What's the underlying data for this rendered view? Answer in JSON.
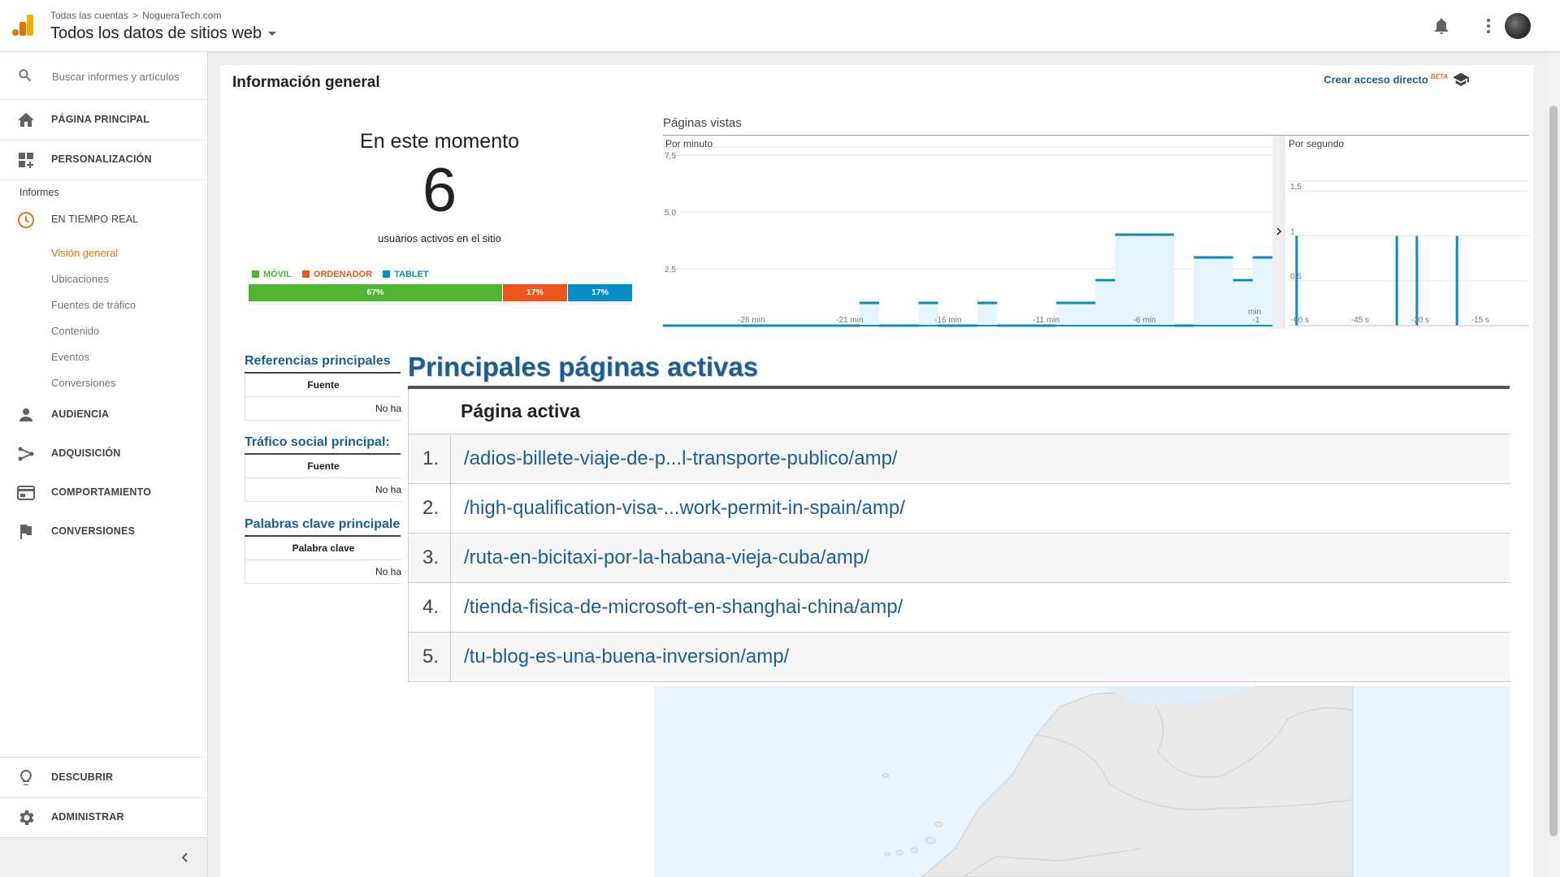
{
  "header": {
    "breadcrumb_root": "Todas las cuentas",
    "breadcrumb_sep": ">",
    "breadcrumb_account": "NogueraTech.com",
    "view_title": "Todos los datos de sitios web"
  },
  "sidebar": {
    "search_placeholder": "Buscar informes y artículos",
    "home": "PÁGINA PRINCIPAL",
    "customization": "PERSONALIZACIÓN",
    "reports_label": "Informes",
    "realtime": "EN TIEMPO REAL",
    "realtime_items": [
      "Visión general",
      "Ubicaciones",
      "Fuentes de tráfico",
      "Contenido",
      "Eventos",
      "Conversiones"
    ],
    "audience": "AUDIENCIA",
    "acquisition": "ADQUISICIÓN",
    "behavior": "COMPORTAMIENTO",
    "conversions": "CONVERSIONES",
    "discover": "DESCUBRIR",
    "admin": "ADMINISTRAR"
  },
  "main": {
    "title": "Información general",
    "shortcut": "Crear acceso directo",
    "beta": "BETA",
    "now_title": "En este momento",
    "active_users": "6",
    "active_users_label": "usuarios activos en el sitio",
    "devices": [
      {
        "label": "MÓVIL",
        "percent": 67,
        "display": "67%",
        "color": "#50b432"
      },
      {
        "label": "ORDENADOR",
        "percent": 17,
        "display": "17%",
        "color": "#ed561b"
      },
      {
        "label": "TABLET",
        "percent": 17,
        "display": "17%",
        "color": "#058dc7"
      }
    ],
    "pageviews_title": "Páginas vistas",
    "per_minute_label": "Por minuto",
    "per_second_label": "Por segundo",
    "referrals_title": "Referencias principales",
    "social_title": "Tráfico social principal:",
    "keywords_title": "Palabras clave principale",
    "source_header": "Fuente",
    "keyword_header": "Palabra clave",
    "no_data": "No ha",
    "active_pages_title": "Principales páginas activas",
    "active_page_header": "Página activa",
    "active_pages": [
      {
        "num": "1.",
        "path": "/adios-billete-viaje-de-p...l-transporte-publico/amp/"
      },
      {
        "num": "2.",
        "path": "/high-qualification-visa-...work-permit-in-spain/amp/"
      },
      {
        "num": "3.",
        "path": "/ruta-en-bicitaxi-por-la-habana-vieja-cuba/amp/"
      },
      {
        "num": "4.",
        "path": "/tienda-fisica-de-microsoft-en-shanghai-china/amp/"
      },
      {
        "num": "5.",
        "path": "/tu-blog-es-una-buena-inversion/amp/"
      }
    ]
  },
  "chart_data": [
    {
      "type": "area",
      "title": "Por minuto",
      "y_ticks": [
        "2,5",
        "5,0",
        "7,5"
      ],
      "ylim": [
        0,
        7.5
      ],
      "x_ticks": [
        "-26 min",
        "-21 min",
        "-16 min",
        "-11 min",
        "-6 min",
        "min -1"
      ],
      "x": [
        -30,
        -29,
        -28,
        -27,
        -26,
        -25,
        -24,
        -23,
        -22,
        -21,
        -20,
        -19,
        -18,
        -17,
        -16,
        -15,
        -14,
        -13,
        -12,
        -11,
        -10,
        -9,
        -8,
        -7,
        -6,
        -5,
        -4,
        -3,
        -2,
        -1
      ],
      "values": [
        0,
        0,
        0,
        0,
        0,
        0,
        0,
        0,
        0,
        0,
        1,
        0,
        0,
        1,
        0,
        0,
        1,
        0,
        0,
        0,
        1,
        1,
        2,
        4,
        4,
        4,
        0,
        3,
        3,
        2,
        3
      ]
    },
    {
      "type": "bar",
      "title": "Por segundo",
      "y_ticks": [
        "0,5",
        "1",
        "1,5"
      ],
      "ylim": [
        0,
        1.9
      ],
      "x_ticks": [
        "-60 s",
        "-45 s",
        "-30 s",
        "-15 s"
      ],
      "x": [
        -60,
        -55,
        -50,
        -45,
        -40,
        -35,
        -30,
        -25,
        -20,
        -15,
        -10,
        -5
      ],
      "values": [
        1,
        0,
        0,
        0,
        0,
        1,
        1,
        0,
        1,
        0,
        0,
        0
      ]
    }
  ],
  "colors": {
    "accent": "#e8710a",
    "link": "#1a5d97",
    "chart_line": "#058dc7",
    "chart_fill": "#e6f4fb"
  }
}
